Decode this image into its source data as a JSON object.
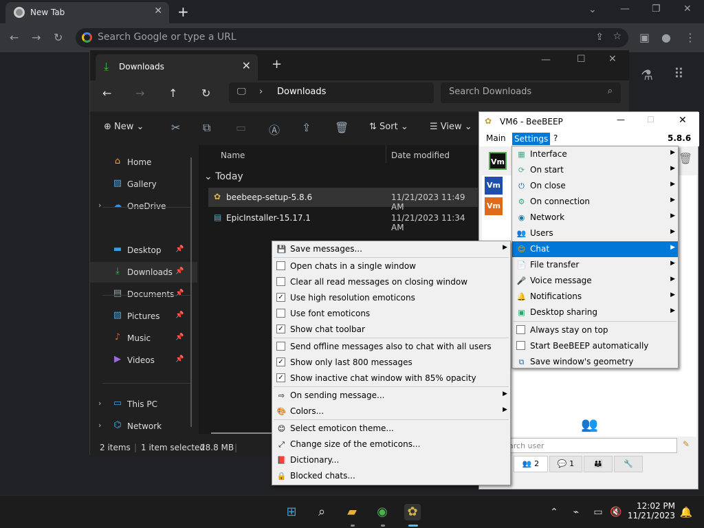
{
  "chrome": {
    "tab_title": "New Tab",
    "omnibox_placeholder": "Search Google or type a URL"
  },
  "explorer": {
    "tab_title": "Downloads",
    "path": "Downloads",
    "search_placeholder": "Search Downloads",
    "toolbar": {
      "new": "New",
      "sort": "Sort",
      "view": "View"
    },
    "sidebar": [
      {
        "label": "Home",
        "icon": "home-icon"
      },
      {
        "label": "Gallery",
        "icon": "gallery-icon"
      },
      {
        "label": "OneDrive",
        "icon": "cloud-icon"
      },
      {
        "label": "Desktop",
        "icon": "desktop-icon"
      },
      {
        "label": "Downloads",
        "icon": "download-icon"
      },
      {
        "label": "Documents",
        "icon": "documents-icon"
      },
      {
        "label": "Pictures",
        "icon": "pictures-icon"
      },
      {
        "label": "Music",
        "icon": "music-icon"
      },
      {
        "label": "Videos",
        "icon": "videos-icon"
      },
      {
        "label": "This PC",
        "icon": "pc-icon"
      },
      {
        "label": "Network",
        "icon": "network-icon"
      }
    ],
    "columns": {
      "name": "Name",
      "date": "Date modified"
    },
    "group": "Today",
    "files": [
      {
        "name": "beebeep-setup-5.8.6",
        "date": "11/21/2023 11:49 AM"
      },
      {
        "name": "EpicInstaller-15.17.1",
        "date": "11/21/2023 11:34 AM"
      }
    ],
    "status": {
      "items": "2 items",
      "selected": "1 item selected",
      "size": "28.8 MB"
    }
  },
  "beebeep": {
    "title": "VM6 - BeeBEEP",
    "menu": {
      "main": "Main",
      "settings": "Settings",
      "help": "?"
    },
    "version": "5.8.6",
    "search_placeholder": "arch user",
    "tab_users": "2",
    "tab_chats": "1"
  },
  "settings_menu": [
    "Interface",
    "On start",
    "On close",
    "On connection",
    "Network",
    "Users",
    "Chat",
    "File transfer",
    "Voice message",
    "Notifications",
    "Desktop sharing",
    "Always stay on top",
    "Start BeeBEEP automatically",
    "Save window's geometry"
  ],
  "chat_menu": [
    "Save messages...",
    "Open chats in a single window",
    "Clear all read messages on closing window",
    "Use high resolution emoticons",
    "Use font emoticons",
    "Show chat toolbar",
    "Send offline messages also to chat with all users",
    "Show only last 800 messages",
    "Show inactive chat window with 85% opacity",
    "On sending message...",
    "Colors...",
    "Select emoticon theme...",
    "Change size of the emoticons...",
    "Dictionary...",
    "Blocked chats..."
  ],
  "clock": {
    "time": "12:02 PM",
    "date": "11/21/2023"
  }
}
